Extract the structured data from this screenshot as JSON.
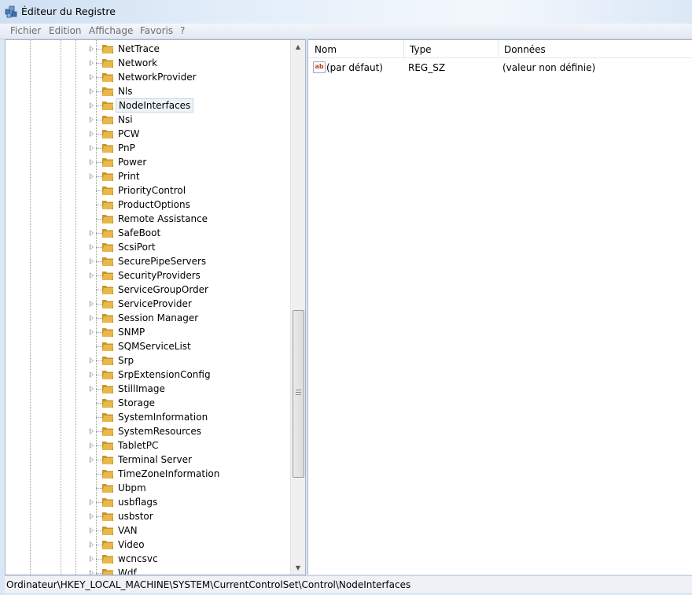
{
  "window": {
    "title": "Éditeur du Registre"
  },
  "menu": [
    "Fichier",
    "Edition",
    "Affichage",
    "Favoris",
    "?"
  ],
  "tree": {
    "selected": "NodeInterfaces",
    "items": [
      {
        "label": "NetTrace",
        "expandable": true
      },
      {
        "label": "Network",
        "expandable": true
      },
      {
        "label": "NetworkProvider",
        "expandable": true
      },
      {
        "label": "Nls",
        "expandable": true
      },
      {
        "label": "NodeInterfaces",
        "expandable": true
      },
      {
        "label": "Nsi",
        "expandable": true
      },
      {
        "label": "PCW",
        "expandable": true
      },
      {
        "label": "PnP",
        "expandable": true
      },
      {
        "label": "Power",
        "expandable": true
      },
      {
        "label": "Print",
        "expandable": true
      },
      {
        "label": "PriorityControl",
        "expandable": false
      },
      {
        "label": "ProductOptions",
        "expandable": false
      },
      {
        "label": "Remote Assistance",
        "expandable": false
      },
      {
        "label": "SafeBoot",
        "expandable": true
      },
      {
        "label": "ScsiPort",
        "expandable": true
      },
      {
        "label": "SecurePipeServers",
        "expandable": true
      },
      {
        "label": "SecurityProviders",
        "expandable": true
      },
      {
        "label": "ServiceGroupOrder",
        "expandable": false
      },
      {
        "label": "ServiceProvider",
        "expandable": true
      },
      {
        "label": "Session Manager",
        "expandable": true
      },
      {
        "label": "SNMP",
        "expandable": true
      },
      {
        "label": "SQMServiceList",
        "expandable": false
      },
      {
        "label": "Srp",
        "expandable": true
      },
      {
        "label": "SrpExtensionConfig",
        "expandable": true
      },
      {
        "label": "StillImage",
        "expandable": true
      },
      {
        "label": "Storage",
        "expandable": false
      },
      {
        "label": "SystemInformation",
        "expandable": false
      },
      {
        "label": "SystemResources",
        "expandable": true
      },
      {
        "label": "TabletPC",
        "expandable": true
      },
      {
        "label": "Terminal Server",
        "expandable": true
      },
      {
        "label": "TimeZoneInformation",
        "expandable": false
      },
      {
        "label": "Ubpm",
        "expandable": false
      },
      {
        "label": "usbflags",
        "expandable": true
      },
      {
        "label": "usbstor",
        "expandable": true
      },
      {
        "label": "VAN",
        "expandable": true
      },
      {
        "label": "Video",
        "expandable": true
      },
      {
        "label": "wcncsvc",
        "expandable": true
      },
      {
        "label": "Wdf",
        "expandable": true
      }
    ]
  },
  "list": {
    "columns": [
      "Nom",
      "Type",
      "Données"
    ],
    "rows": [
      {
        "icon": "string-value-icon",
        "icon_text": "ab",
        "name": "(par défaut)",
        "type": "REG_SZ",
        "data": "(valeur non définie)"
      }
    ]
  },
  "status": {
    "path": "Ordinateur\\HKEY_LOCAL_MACHINE\\SYSTEM\\CurrentControlSet\\Control\\NodeInterfaces"
  },
  "colors": {
    "folder": "#e8b94a",
    "folder_dark": "#c8952a",
    "selection_border": "#c5d4e6"
  }
}
